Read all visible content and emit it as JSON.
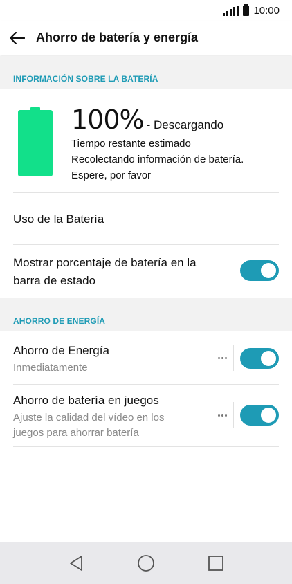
{
  "status_bar": {
    "time": "10:00"
  },
  "app_bar": {
    "title": "Ahorro de batería y energía"
  },
  "battery_section": {
    "header": "INFORMACIÓN SOBRE LA BATERÍA",
    "level_percent": 100,
    "percent_label": "100%",
    "state": "- Descargando",
    "estimate_lines": [
      "Tiempo restante estimado",
      "Recolectando información de batería.",
      "Espere, por favor"
    ]
  },
  "battery_usage": {
    "label": "Uso de la Batería"
  },
  "show_percentage": {
    "label_line1": "Mostrar porcentaje de batería en la",
    "label_line2": "barra de estado",
    "enabled": true
  },
  "energy_section": {
    "header": "AHORRO DE ENERGÍA",
    "items": [
      {
        "title": "Ahorro de Energía",
        "subtitle_line1": "Inmediatamente",
        "enabled": true
      },
      {
        "title": "Ahorro de batería en juegos",
        "subtitle_line1": "Ajuste la calidad del vídeo en los",
        "subtitle_line2": "juegos para ahorrar batería",
        "enabled": true
      }
    ]
  },
  "colors": {
    "accent": "#1e9bb5",
    "battery": "#12e08a"
  },
  "icons": {
    "back": "arrow-left-icon",
    "nav_back": "triangle-back-icon",
    "nav_home": "circle-home-icon",
    "nav_recent": "square-recent-icon"
  }
}
